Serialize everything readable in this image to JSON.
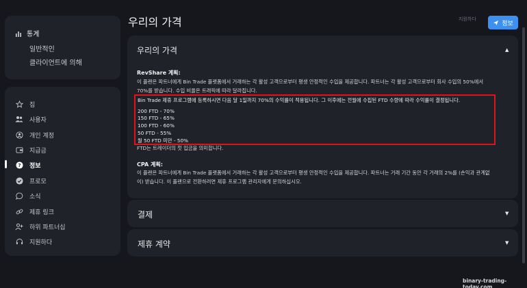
{
  "sidebar": {
    "stats_title": "통계",
    "stats_general": "일반적인",
    "stats_by_client": "클라이언트에 의해",
    "items": [
      {
        "label": "집",
        "icon": "star-icon"
      },
      {
        "label": "사용자",
        "icon": "users-icon"
      },
      {
        "label": "개인 계정",
        "icon": "user-icon"
      },
      {
        "label": "지급금",
        "icon": "wallet-icon"
      },
      {
        "label": "정보",
        "icon": "question-icon"
      },
      {
        "label": "프로모",
        "icon": "check-badge-icon"
      },
      {
        "label": "소식",
        "icon": "chat-icon"
      },
      {
        "label": "제휴 링크",
        "icon": "link-icon"
      },
      {
        "label": "하위 파트너십",
        "icon": "user-plus-icon"
      },
      {
        "label": "지원하다",
        "icon": "headset-icon"
      }
    ],
    "active_item": "정보"
  },
  "header": {
    "title": "우리의 가격",
    "support_link": "지원하다",
    "info_button": "정보"
  },
  "panel": {
    "title": "우리의 가격",
    "revshare": {
      "heading": "RevShare 계획:",
      "para_lines": [
        "이 플랜은 파트너에게 Bin Trade 플랫폼에서 거래하는 각 활성 고객으로부터 평생 안정적인 수입을 제공합니다. 파트너는 각 활성 고객으로부터 회사 수입의 50%에서",
        "70%를 받습니다. 수입 비율은 트래픽에 따라 달라집니다."
      ],
      "highlight_intro": "Bin Trade 제휴 프로그램에 등록하시면 다음 달 1일까지 70%의 수익률이 적용됩니다. 그 이후에는 전월에 수집된 FTD 수량에 따라 수익률이 결정됩니다.",
      "tiers": [
        "200 FTD - 70%",
        "150 FTD - 65%",
        "100 FTD - 60%",
        "50 FTD - 55%",
        "월 50 FTD 미만 - 50%"
      ],
      "ftd_note": "FTD는 트레이더의 첫 입금을 의미합니다."
    },
    "cpa": {
      "heading": "CPA 계획:",
      "para_lines": [
        "이 플랜은 파트너에게 Bin Trade 플랫폼에서 거래하는 각 활성 고객으로부터 평생 안정적인 수입을 제공합니다. 파트너는 거래 기간 동안 각 거래의 2%를 (손익과 관계없",
        "이) 받습니다. 이 플랜으로 전환하려면 제휴 프로그램 관리자에게 문의하십시오."
      ]
    }
  },
  "accordions": [
    {
      "label": "결제"
    },
    {
      "label": "제휴 계약"
    }
  ],
  "watermark": "binary-trading-today.com",
  "colors": {
    "accent": "#3d8ff0",
    "highlight_border": "#e0151c",
    "background": "#15171c",
    "card": "#1f2228"
  }
}
